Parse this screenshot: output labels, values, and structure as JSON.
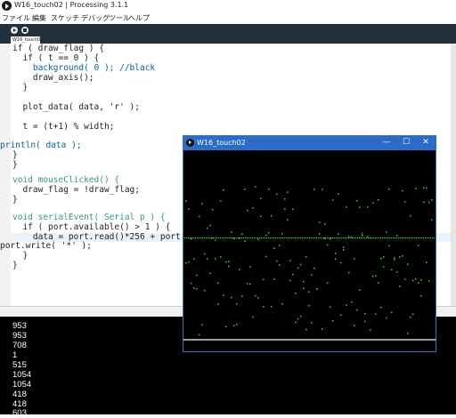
{
  "window": {
    "title": "W16_touch02 | Processing 3.1.1"
  },
  "menu": [
    "ファイル",
    "編集",
    "スケッチ",
    "デバッグ",
    "ツール",
    "ヘルプ"
  ],
  "tab": {
    "label": "W16_touch02"
  },
  "code_lines": [
    "if ( draw_flag ) {",
    "  if ( t == 0 ) {",
    "    background( 0 ); //black",
    "    draw_axis();",
    "  }",
    "",
    "  plot_data( data, 'r' );",
    "",
    "  t = (t+1) % width;",
    "",
    "println( data );",
    "}",
    "}",
    "",
    "void mouseClicked() {",
    "  draw_flag = !draw_flag;",
    "}",
    "",
    "void serialEvent( Serial p ) {",
    "  if ( port.available() > 1 ) {",
    "    data = port.read()*256 + port.read",
    "port.write( '*' );",
    "  }",
    "}"
  ],
  "console_lines": [
    "953",
    "953",
    "708",
    "1",
    "515",
    "1054",
    "1054",
    "418",
    "418",
    "603"
  ],
  "sketch_window": {
    "title": "W16_touch02",
    "minimize": "—",
    "maximize": "☐",
    "close": "✕",
    "bg": "#000000",
    "dot_color": "#33dd33",
    "axis_color": "#cfcfcf"
  }
}
